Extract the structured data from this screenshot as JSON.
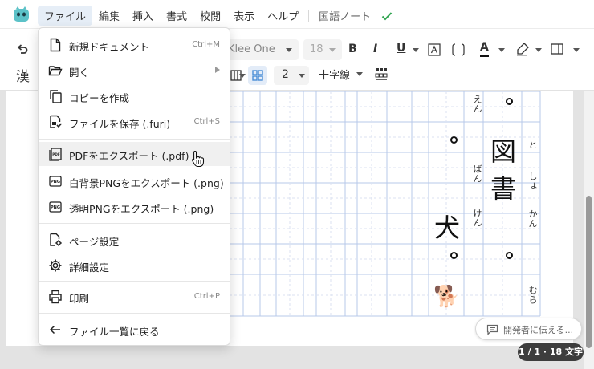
{
  "colors": {
    "accent": "#2ea44f",
    "grid_line": "#b7c8ea",
    "layout_active": "#e3ecf8",
    "badge_bg": "#3d3d3d"
  },
  "menubar": {
    "items": [
      "ファイル",
      "編集",
      "挿入",
      "書式",
      "校閲",
      "表示",
      "ヘルプ"
    ],
    "document_title": "国語ノート",
    "saved_icon": "check-icon"
  },
  "toolbar": {
    "kanji_button": "漢",
    "font": "Klee One",
    "font_size": "18",
    "columns_value": "2",
    "guide_label": "十字線"
  },
  "file_menu": {
    "items": [
      {
        "icon": "new-document-icon",
        "label": "新規ドキュメント",
        "shortcut": "Ctrl+M"
      },
      {
        "icon": "folder-open-icon",
        "label": "開く",
        "submenu": true
      },
      {
        "icon": "copy-icon",
        "label": "コピーを作成"
      },
      {
        "icon": "save-icon",
        "label": "ファイルを保存 (.furi)",
        "shortcut": "Ctrl+S"
      },
      {
        "icon": "pdf-icon",
        "label": "PDFをエクスポート (.pdf)",
        "hovered": true
      },
      {
        "icon": "png-icon",
        "label": "白背景PNGをエクスポート (.png)"
      },
      {
        "icon": "png-icon",
        "label": "透明PNGをエクスポート (.png)"
      },
      {
        "icon": "page-settings-icon",
        "label": "ページ設定"
      },
      {
        "icon": "gear-icon",
        "label": "詳細設定"
      },
      {
        "icon": "printer-icon",
        "label": "印刷",
        "shortcut": "Ctrl+P"
      },
      {
        "icon": "arrow-left-icon",
        "label": "ファイル一覧に戻る"
      }
    ]
  },
  "document": {
    "kanji": [
      "図",
      "書",
      "犬"
    ],
    "furigana": [
      "と",
      "しょ",
      "かん",
      "むら",
      "えん",
      "ばん",
      "けん"
    ],
    "emoji": "🐕"
  },
  "status": {
    "feedback_label": "開発者に伝える...",
    "count": "1 / 1 · 18 文字"
  }
}
